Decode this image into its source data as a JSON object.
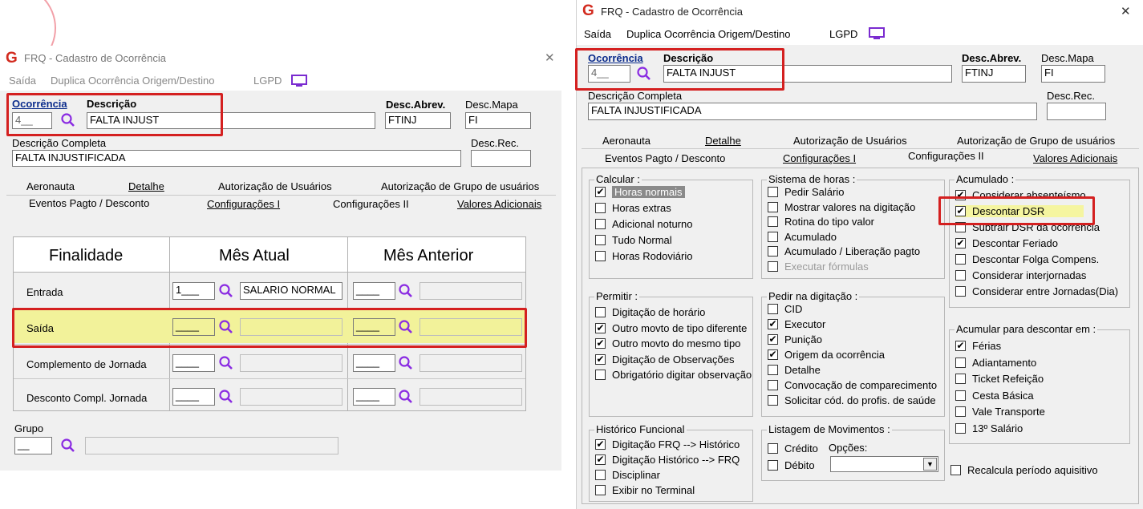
{
  "left": {
    "title": "FRQ - Cadastro de Ocorrência",
    "menu": [
      "Saída",
      "Duplica Ocorrência Origem/Destino",
      "LGPD"
    ],
    "ocorrencia_label": "Ocorrência",
    "ocorrencia_value": "4__",
    "descricao_label": "Descrição",
    "descricao_value": "FALTA INJUST",
    "desc_abrev_label": "Desc.Abrev.",
    "desc_abrev_value": "FTINJ",
    "desc_mapa_label": "Desc.Mapa",
    "desc_mapa_value": "FI",
    "descricao_completa_label": "Descrição Completa",
    "descricao_completa_value": "FALTA INJUSTIFICADA",
    "desc_rec_label": "Desc.Rec.",
    "tabs_row1": [
      "Aeronauta",
      "Detalhe",
      "Autorização de Usuários",
      "Autorização de Grupo de usuários"
    ],
    "tabs_row2": [
      "Eventos Pagto / Desconto",
      "Configurações I",
      "Configurações II",
      "Valores Adicionais"
    ],
    "grid_headers": [
      "Finalidade",
      "Mês Atual",
      "Mês Anterior"
    ],
    "rows": [
      {
        "label": "Entrada",
        "atual_code": "1___",
        "atual_desc": "SALARIO NORMAL",
        "ant_code": "____"
      },
      {
        "label": "Saída",
        "atual_code": "____",
        "atual_desc": "",
        "ant_code": "____"
      },
      {
        "label": "Complemento de Jornada",
        "atual_code": "____",
        "atual_desc": "",
        "ant_code": "____"
      },
      {
        "label": "Desconto Compl. Jornada",
        "atual_code": "____",
        "atual_desc": "",
        "ant_code": "____"
      }
    ],
    "grupo_label": "Grupo",
    "grupo_value": "__"
  },
  "right": {
    "title": "FRQ - Cadastro de Ocorrência",
    "close": "✕",
    "menu": [
      "Saída",
      "Duplica Ocorrência Origem/Destino",
      "LGPD"
    ],
    "ocorrencia_label": "Ocorrência",
    "ocorrencia_value": "4__",
    "descricao_label": "Descrição",
    "descricao_value": "FALTA INJUST",
    "desc_abrev_label": "Desc.Abrev.",
    "desc_abrev_value": "FTINJ",
    "desc_mapa_label": "Desc.Mapa",
    "desc_mapa_value": "FI",
    "descricao_completa_label": "Descrição Completa",
    "descricao_completa_value": "FALTA INJUSTIFICADA",
    "desc_rec_label": "Desc.Rec.",
    "tabs_row1": [
      "Aeronauta",
      "Detalhe",
      "Autorização de Usuários",
      "Autorização de Grupo de usuários"
    ],
    "tabs_row2": [
      "Eventos Pagto / Desconto",
      "Configurações I",
      "Configurações II",
      "Valores Adicionais"
    ],
    "calcular": {
      "title": "Calcular :",
      "items": [
        {
          "label": "Horas normais",
          "checked": true
        },
        {
          "label": "Horas extras",
          "checked": false
        },
        {
          "label": "Adicional noturno",
          "checked": false
        },
        {
          "label": "Tudo Normal",
          "checked": false
        },
        {
          "label": "Horas Rodoviário",
          "checked": false
        }
      ]
    },
    "sistema": {
      "title": "Sistema de horas :",
      "items": [
        {
          "label": "Pedir Salário",
          "checked": false
        },
        {
          "label": "Mostrar valores na digitação",
          "checked": false
        },
        {
          "label": "Rotina do tipo valor",
          "checked": false
        },
        {
          "label": "Acumulado",
          "checked": false
        },
        {
          "label": "Acumulado / Liberação pagto",
          "checked": false
        },
        {
          "label": "Executar fórmulas",
          "checked": false
        }
      ]
    },
    "acumulado": {
      "title": "Acumulado :",
      "items": [
        {
          "label": "Considerar absenteísmo",
          "checked": true
        },
        {
          "label": "Descontar DSR",
          "checked": true
        },
        {
          "label": "Subtrair DSR da ocorrência",
          "checked": false
        },
        {
          "label": "Descontar Feriado",
          "checked": true
        },
        {
          "label": "Descontar Folga Compens.",
          "checked": false
        },
        {
          "label": "Considerar interjornadas",
          "checked": false
        },
        {
          "label": "Considerar entre Jornadas(Dia)",
          "checked": false
        }
      ]
    },
    "permitir": {
      "title": "Permitir :",
      "items": [
        {
          "label": "Digitação de horário",
          "checked": false
        },
        {
          "label": "Outro movto de tipo diferente",
          "checked": true
        },
        {
          "label": "Outro movto do mesmo tipo",
          "checked": true
        },
        {
          "label": "Digitação de Observações",
          "checked": true
        },
        {
          "label": "Obrigatório digitar observação",
          "checked": false
        }
      ]
    },
    "pedir": {
      "title": "Pedir na digitação :",
      "items": [
        {
          "label": "CID",
          "checked": false
        },
        {
          "label": "Executor",
          "checked": true
        },
        {
          "label": "Punição",
          "checked": true
        },
        {
          "label": "Origem da ocorrência",
          "checked": true
        },
        {
          "label": "Detalhe",
          "checked": false
        },
        {
          "label": "Convocação de comparecimento",
          "checked": false
        },
        {
          "label": "Solicitar cód. do profis. de saúde",
          "checked": false
        }
      ]
    },
    "acumular": {
      "title": "Acumular para descontar em :",
      "items": [
        {
          "label": "Férias",
          "checked": true
        },
        {
          "label": "Adiantamento",
          "checked": false
        },
        {
          "label": "Ticket Refeição",
          "checked": false
        },
        {
          "label": "Cesta Básica",
          "checked": false
        },
        {
          "label": "Vale Transporte",
          "checked": false
        },
        {
          "label": "13º Salário",
          "checked": false
        }
      ]
    },
    "historico": {
      "title": "Histórico Funcional",
      "items": [
        {
          "label": "Digitação FRQ --> Histórico",
          "checked": true
        },
        {
          "label": "Digitação Histórico --> FRQ",
          "checked": true
        },
        {
          "label": "Disciplinar",
          "checked": false
        },
        {
          "label": "Exibir no Terminal",
          "checked": false
        }
      ]
    },
    "listagem": {
      "title": "Listagem de Movimentos :",
      "opcoes_label": "Opções:",
      "items": [
        {
          "label": "Crédito",
          "checked": false
        },
        {
          "label": "Débito",
          "checked": false
        }
      ]
    },
    "recalcula": {
      "label": "Recalcula período aquisitivo",
      "checked": false
    },
    "check_mark": "✔"
  },
  "colors": {
    "highlight_red": "#d42020",
    "yellow_row": "#f2f29a",
    "brand_red": "#d22a1e",
    "lgpd_purple": "#7a2bd0",
    "tab_bg": "#f0f0f0"
  }
}
